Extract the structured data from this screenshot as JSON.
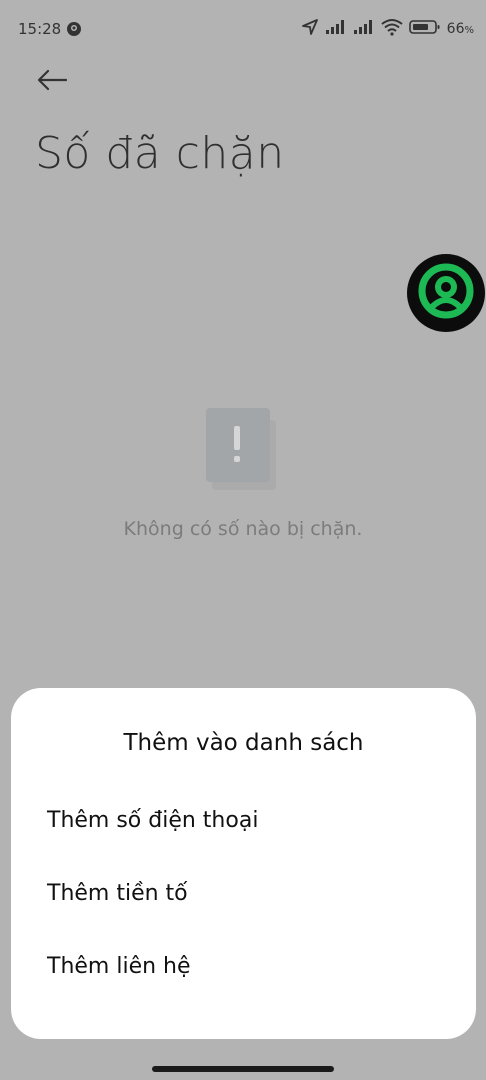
{
  "status_bar": {
    "time": "15:28",
    "battery_percent": "66",
    "battery_unit": "%",
    "icons": [
      "location-icon",
      "cell-signal-icon",
      "cell-signal-icon",
      "wifi-icon",
      "battery-icon"
    ]
  },
  "header": {
    "title": "Số đã chặn",
    "back_icon": "back-arrow-icon"
  },
  "empty_state": {
    "icon": "alert-document-icon",
    "message": "Không có số nào bị chặn."
  },
  "bottom_sheet": {
    "title": "Thêm vào danh sách",
    "options": [
      {
        "label": "Thêm số điện thoại"
      },
      {
        "label": "Thêm tiền tố"
      },
      {
        "label": "Thêm liên hệ"
      }
    ]
  },
  "colors": {
    "scrim": "#b3b3b3",
    "sheet_background": "#ffffff",
    "bubble_accent": "#1db954"
  }
}
